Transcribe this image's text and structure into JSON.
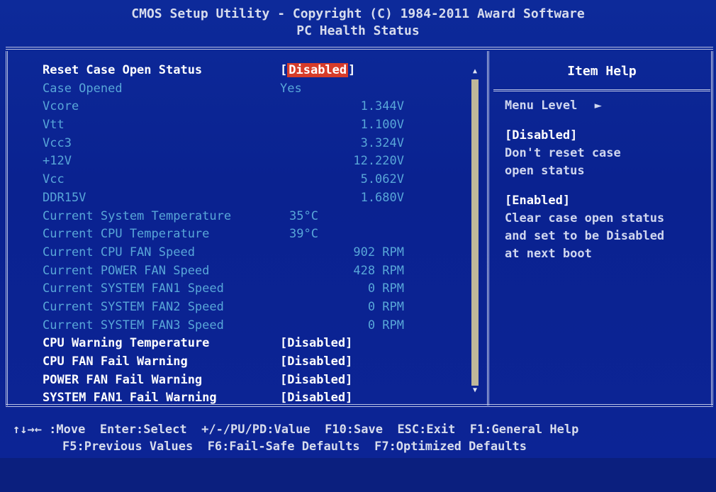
{
  "header": {
    "title": "CMOS Setup Utility - Copyright (C) 1984-2011 Award Software",
    "subtitle": "PC Health Status"
  },
  "settings": [
    {
      "label": "Reset Case Open Status",
      "value": "Disabled",
      "kind": "active",
      "selected": true
    },
    {
      "label": "Case Opened",
      "value": "Yes",
      "kind": "info"
    },
    {
      "label": "Vcore",
      "value": "1.344V",
      "kind": "info",
      "align": "right"
    },
    {
      "label": "Vtt",
      "value": "1.100V",
      "kind": "info",
      "align": "right"
    },
    {
      "label": "Vcc3",
      "value": "3.324V",
      "kind": "info",
      "align": "right"
    },
    {
      "label": "+12V",
      "value": "12.220V",
      "kind": "info",
      "align": "right"
    },
    {
      "label": "Vcc",
      "value": "5.062V",
      "kind": "info",
      "align": "right"
    },
    {
      "label": "DDR15V",
      "value": "1.680V",
      "kind": "info",
      "align": "right"
    },
    {
      "label": "Current System Temperature",
      "value": "35°C",
      "kind": "info",
      "align": "temp"
    },
    {
      "label": "Current CPU Temperature",
      "value": "39°C",
      "kind": "info",
      "align": "temp"
    },
    {
      "label": "Current CPU FAN Speed",
      "value": "902 RPM",
      "kind": "info",
      "align": "right"
    },
    {
      "label": "Current POWER FAN Speed",
      "value": "428 RPM",
      "kind": "info",
      "align": "right"
    },
    {
      "label": "Current SYSTEM FAN1 Speed",
      "value": "0 RPM",
      "kind": "info",
      "align": "right"
    },
    {
      "label": "Current SYSTEM FAN2 Speed",
      "value": "0 RPM",
      "kind": "info",
      "align": "right"
    },
    {
      "label": "Current SYSTEM FAN3 Speed",
      "value": "0 RPM",
      "kind": "info",
      "align": "right"
    },
    {
      "label": "CPU Warning Temperature",
      "value": "Disabled",
      "kind": "active"
    },
    {
      "label": "CPU FAN Fail Warning",
      "value": "Disabled",
      "kind": "active"
    },
    {
      "label": "POWER FAN Fail Warning",
      "value": "Disabled",
      "kind": "active"
    },
    {
      "label": "SYSTEM FAN1 Fail Warning",
      "value": "Disabled",
      "kind": "active"
    }
  ],
  "help": {
    "heading": "Item Help",
    "menu_level": "Menu Level",
    "menu_level_arrow": "►",
    "disabled_title": "[Disabled]",
    "disabled_lines": [
      "Don't reset case",
      "open status"
    ],
    "enabled_title": "[Enabled]",
    "enabled_lines": [
      "Clear case open status",
      "and set to be Disabled",
      "at next boot"
    ]
  },
  "scroll": {
    "up": "▲",
    "down": "▼"
  },
  "footer": {
    "line1": "↑↓→← :Move  Enter:Select  +/-/PU/PD:Value  F10:Save  ESC:Exit  F1:General Help",
    "line2": "F5:Previous Values  F6:Fail-Safe Defaults  F7:Optimized Defaults"
  },
  "colors": {
    "background": "#0b2490",
    "info_text": "#58a6d8",
    "active_text": "#ffffff",
    "selection": "#d63c2a",
    "scrollbar": "#bfb89a"
  }
}
